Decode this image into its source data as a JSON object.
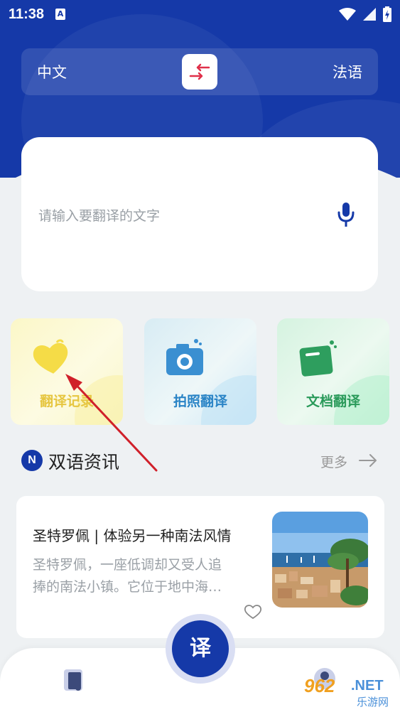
{
  "status_bar": {
    "time": "11:38",
    "notification_glyph": "A"
  },
  "language_bar": {
    "source_lang": "中文",
    "target_lang": "法语",
    "swap_icon": "swap-arrows-icon"
  },
  "input": {
    "placeholder": "请输入要翻译的文字",
    "mic_icon": "microphone-icon"
  },
  "features": [
    {
      "label": "翻译记录",
      "icon": "heart-icon",
      "color": "#e6c640"
    },
    {
      "label": "拍照翻译",
      "icon": "camera-icon",
      "color": "#2a84c6"
    },
    {
      "label": "文档翻译",
      "icon": "document-icon",
      "color": "#2a9a5a"
    }
  ],
  "news_section": {
    "badge": "N",
    "title": "双语资讯",
    "more_label": "更多"
  },
  "news_items": [
    {
      "title": "圣特罗佩 | 体验另一种南法风情",
      "desc_line1": "圣特罗佩，一座低调却又受人追",
      "desc_line2": "捧的南法小镇。它位于地中海…"
    }
  ],
  "bottom_nav": {
    "center_label": "译"
  },
  "watermark": {
    "number": "962",
    "net": ".NET",
    "sub": "乐游网"
  },
  "colors": {
    "primary": "#1539a8",
    "background": "#eef1f3",
    "swap_accent": "#e0304a"
  }
}
